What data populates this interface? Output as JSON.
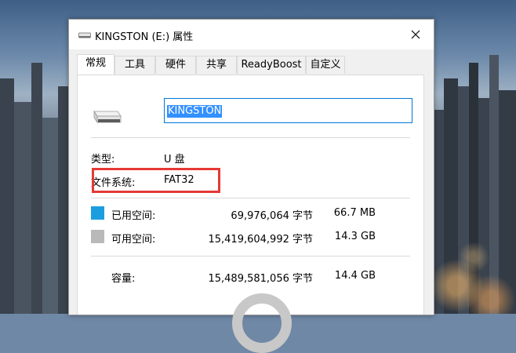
{
  "window": {
    "title": "KINGSTON (E:) 属性"
  },
  "tabs": [
    {
      "label": "常规",
      "active": true
    },
    {
      "label": "工具",
      "active": false
    },
    {
      "label": "硬件",
      "active": false
    },
    {
      "label": "共享",
      "active": false
    },
    {
      "label": "ReadyBoost",
      "active": false
    },
    {
      "label": "自定义",
      "active": false
    }
  ],
  "general": {
    "volume_name": "KINGSTON",
    "type_label": "类型:",
    "type_value": "U 盘",
    "filesystem_label": "文件系统:",
    "filesystem_value": "FAT32",
    "used_label": "已用空间:",
    "used_bytes": "69,976,064 字节",
    "used_size": "66.7 MB",
    "free_label": "可用空间:",
    "free_bytes": "15,419,604,992 字节",
    "free_size": "14.3 GB",
    "capacity_label": "容量:",
    "capacity_bytes": "15,489,581,056 字节",
    "capacity_size": "14.4 GB"
  },
  "colors": {
    "used": "#1a9ee0",
    "free": "#b9b9b9",
    "highlight": "#e53935"
  },
  "icons": [
    "usb-drive-icon",
    "close-icon"
  ]
}
